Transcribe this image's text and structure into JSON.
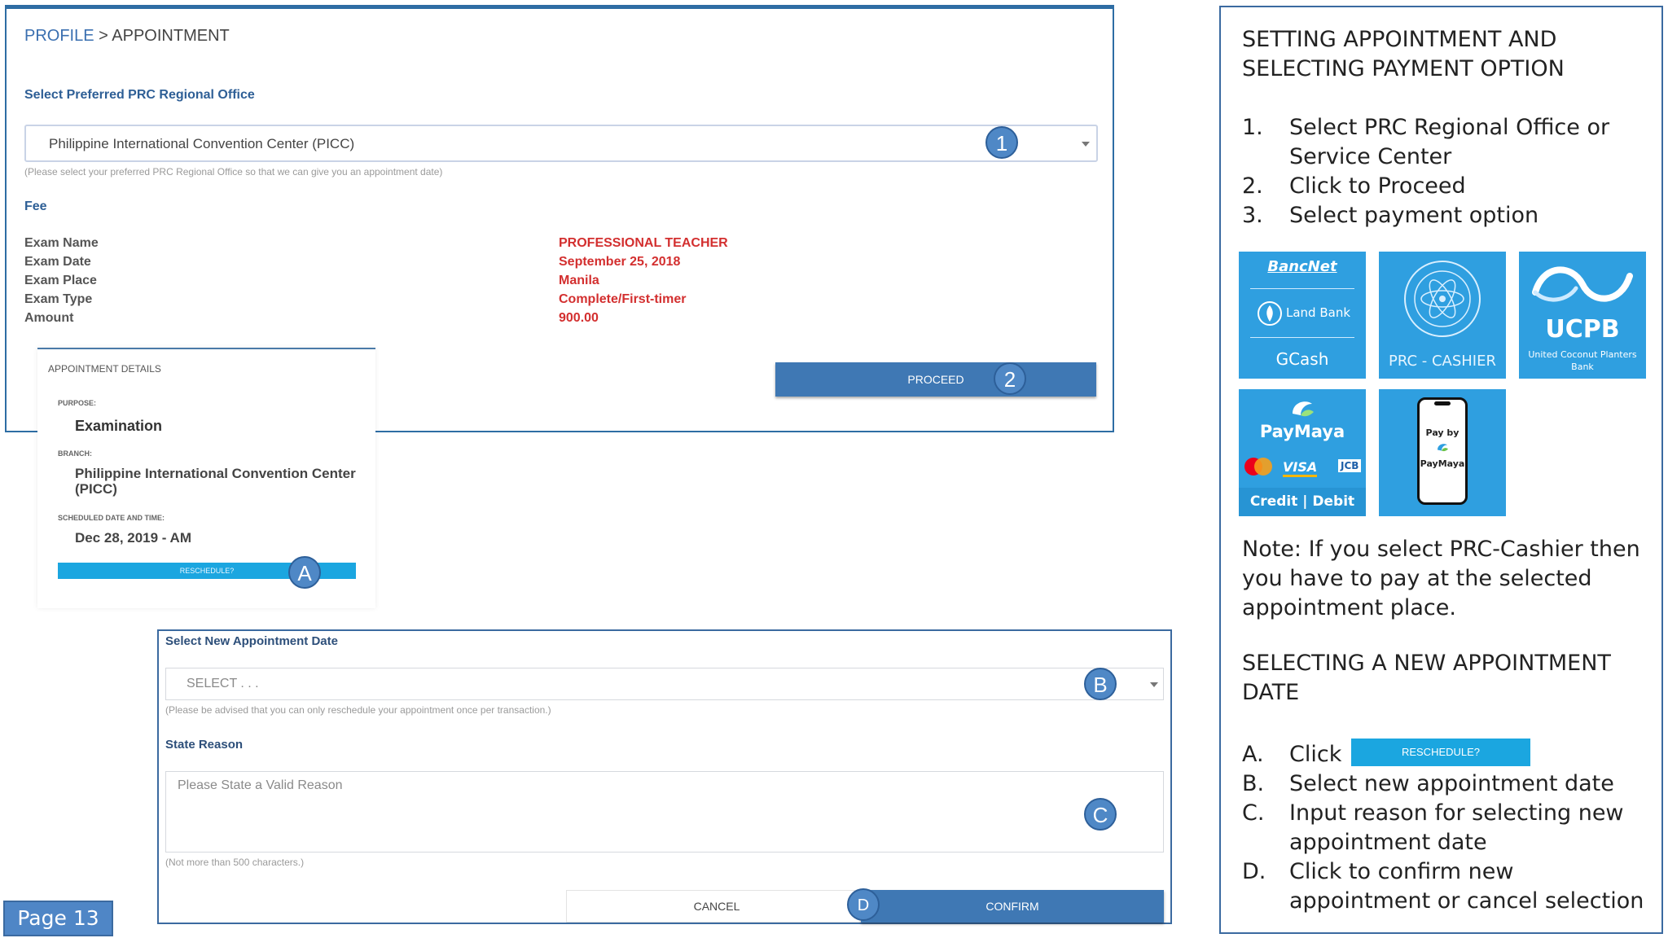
{
  "breadcrumb": {
    "parent": "PROFILE",
    "separator": " > ",
    "current": "APPOINTMENT"
  },
  "office": {
    "label": "Select Preferred PRC Regional Office",
    "selected": "Philippine International Convention Center (PICC)",
    "hint": "(Please select your preferred PRC Regional Office so that we can give you an appointment date)"
  },
  "fee": {
    "title": "Fee",
    "rows": [
      {
        "label": "Exam Name",
        "value": "PROFESSIONAL TEACHER"
      },
      {
        "label": "Exam Date",
        "value": "September 25, 2018"
      },
      {
        "label": "Exam Place",
        "value": "Manila"
      },
      {
        "label": "Exam Type",
        "value": "Complete/First-timer"
      },
      {
        "label": "Amount",
        "value": "900.00"
      }
    ]
  },
  "proceed_label": "PROCEED",
  "details": {
    "title": "APPOINTMENT DETAILS",
    "purpose_label": "PURPOSE:",
    "purpose": "Examination",
    "branch_label": "BRANCH:",
    "branch_line1": "Philippine International Convention Center",
    "branch_line2": "(PICC)",
    "schedule_label": "SCHEDULED DATE AND TIME:",
    "schedule": "Dec 28, 2019 - AM",
    "reschedule_label": "RESCHEDULE?"
  },
  "form": {
    "date_label": "Select New Appointment Date",
    "date_placeholder": "SELECT . . .",
    "date_hint": "(Please be advised that you can only reschedule your appointment once per transaction.)",
    "reason_label": "State Reason",
    "reason_placeholder": "Please State a Valid Reason",
    "reason_hint": "(Not more than 500 characters.)",
    "cancel_label": "CANCEL",
    "confirm_label": "CONFIRM"
  },
  "badges": {
    "b1": "1",
    "b2": "2",
    "bA": "A",
    "bB": "B",
    "bC": "C",
    "bD": "D"
  },
  "right": {
    "heading1": "SETTING APPOINTMENT AND",
    "heading2": "SELECTING PAYMENT OPTION",
    "steps": [
      {
        "num": "1.",
        "line1": "Select PRC Regional Office or",
        "line2": "Service Center"
      },
      {
        "num": "2.",
        "line1": "Click to Proceed"
      },
      {
        "num": "3.",
        "line1": "Select payment option"
      }
    ],
    "tiles": {
      "bancnet": "BancNet",
      "landbank": "Land Bank",
      "gcash": "GCash",
      "prc_cashier": "PRC - CASHIER",
      "ucpb": "UCPB",
      "ucpb_sub1": "United Coconut Planters",
      "ucpb_sub2": "Bank",
      "paymaya": "PayMaya",
      "visa": "VISA",
      "jcb": "JCB",
      "credit_debit": "Credit | Debit",
      "payby": "Pay by",
      "paymaya2": "PayMaya"
    },
    "note1": "Note: If you select PRC-Cashier then",
    "note2": "you have to pay at the selected",
    "note3": "appointment place.",
    "heading3": "SELECTING A NEW APPOINTMENT",
    "heading4": "DATE",
    "substeps": [
      {
        "num": "A.",
        "line1": "Click",
        "button": "RESCHEDULE?"
      },
      {
        "num": "B.",
        "line1": "Select new appointment date"
      },
      {
        "num": "C.",
        "line1": "Input reason for selecting new",
        "line2": "appointment date"
      },
      {
        "num": "D.",
        "line1": "Click to confirm new",
        "line2": "appointment or cancel selection"
      }
    ]
  },
  "page_label": "Page 13",
  "colors": {
    "accent": "#3f78b4",
    "fee_red": "#d32f2f",
    "tile_blue": "#2f9fe0",
    "reschedule_cyan": "#1ba6e0"
  }
}
